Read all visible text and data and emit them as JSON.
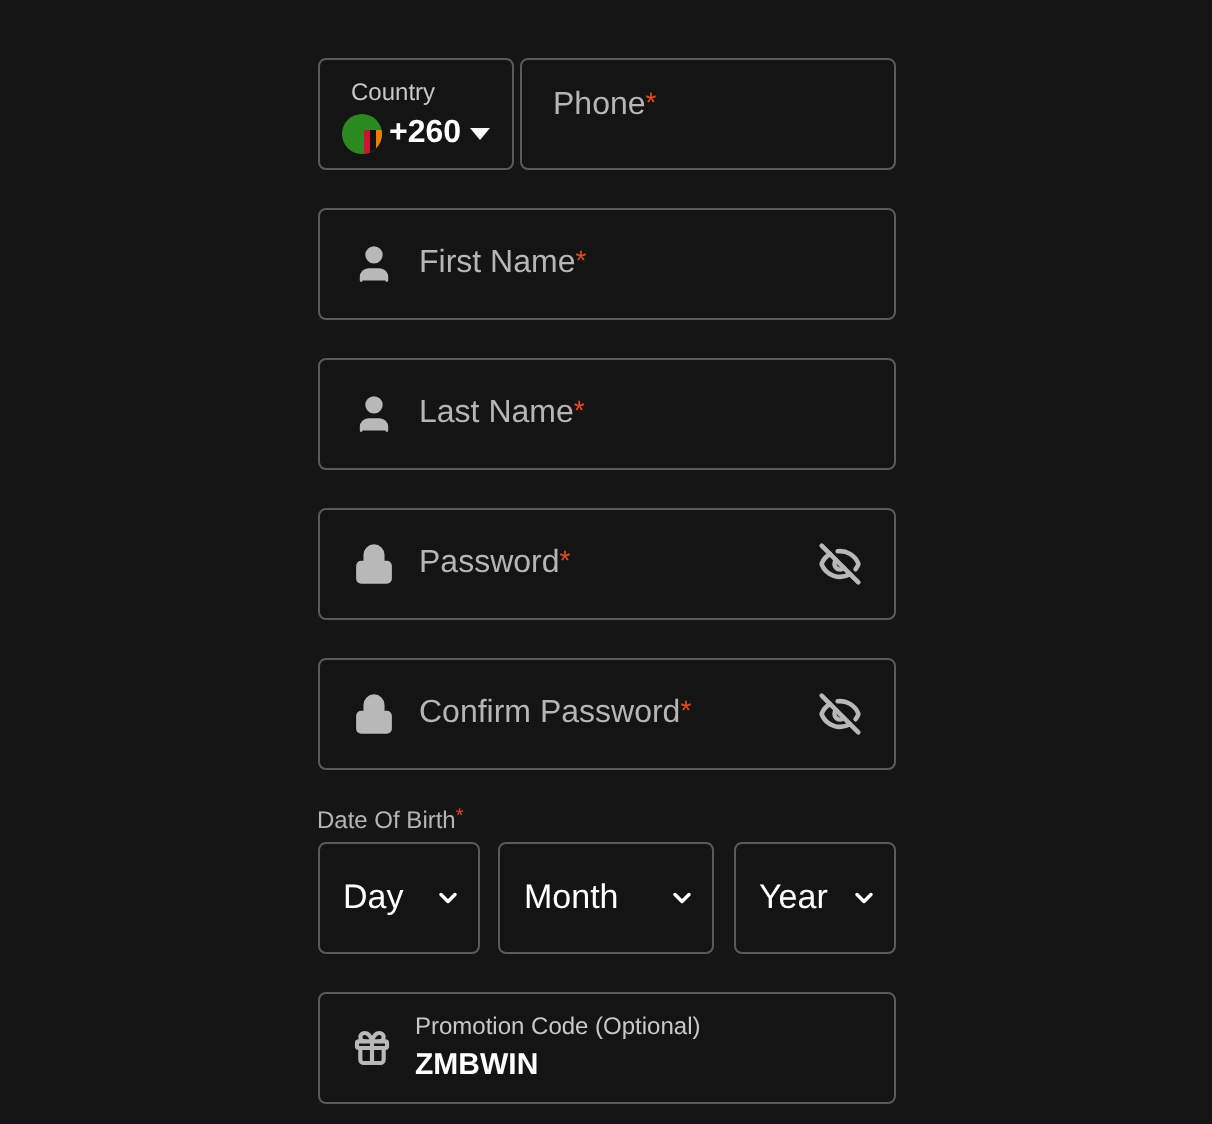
{
  "country": {
    "label": "Country",
    "code": "+260"
  },
  "phone": {
    "placeholder": "Phone",
    "required_mark": "*"
  },
  "fields": [
    {
      "kind": "user",
      "placeholder": "First Name",
      "required_mark": "*"
    },
    {
      "kind": "user",
      "placeholder": "Last Name",
      "required_mark": "*"
    },
    {
      "kind": "password",
      "placeholder": "Password",
      "required_mark": "*"
    },
    {
      "kind": "password",
      "placeholder": "Confirm Password",
      "required_mark": "*"
    }
  ],
  "date_of_birth": {
    "label": "Date Of Birth",
    "required_mark": "*",
    "selects": [
      "Day",
      "Month",
      "Year"
    ]
  },
  "promotion": {
    "label": "Promotion Code (Optional)",
    "value": "ZMBWIN"
  }
}
